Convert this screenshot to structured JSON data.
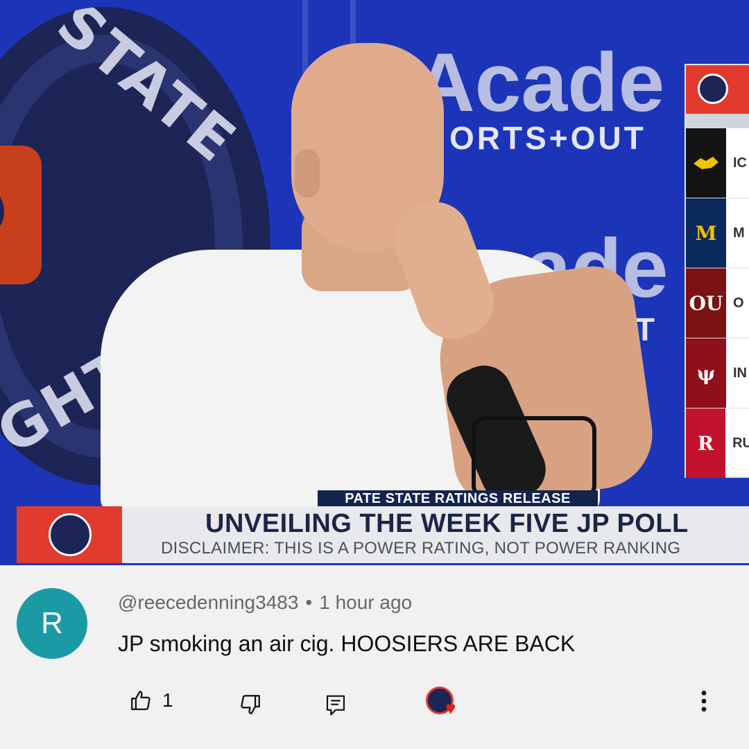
{
  "video": {
    "wall_logo_words": [
      "STATE",
      "GHT"
    ],
    "academy_text_1": "Acade",
    "academy_sub_1": "ORTS+OUT",
    "academy_text_2": "cade",
    "academy_sub_2": "+OUT",
    "standings_rows": [
      {
        "icon": "hawkeye-icon",
        "abbr": "IC",
        "color": "#141414",
        "icon_color": "#f2c200"
      },
      {
        "icon": "block-m-icon",
        "glyph": "M",
        "abbr": "M",
        "color": "#0b2a5b",
        "icon_color": "#f2c200"
      },
      {
        "icon": "ou-icon",
        "glyph": "OU",
        "abbr": "O",
        "color": "#7b1213",
        "icon_color": "#ffffff"
      },
      {
        "icon": "trident-icon",
        "glyph": "ψ",
        "abbr": "IN",
        "color": "#8f0f1a",
        "icon_color": "#ffffff"
      },
      {
        "icon": "block-r-icon",
        "glyph": "R",
        "abbr": "RU",
        "color": "#c3122e",
        "icon_color": "#ffffff"
      }
    ],
    "lower_third": {
      "tag": "PATE STATE RATINGS RELEASE",
      "headline": "UNVEILING THE WEEK FIVE JP POLL",
      "disclaimer": "DISCLAIMER: THIS IS A POWER RATING, NOT POWER RANKING"
    }
  },
  "comment": {
    "avatar_letter": "R",
    "author": "@reecedenning3483",
    "separator": "•",
    "time": "1 hour ago",
    "text": "JP smoking an air cig. HOOSIERS ARE BACK",
    "like_count": "1"
  },
  "colors": {
    "background": "#f1f1f1",
    "avatar": "#1a9aa5",
    "brand_red": "#e13a2f",
    "heart": "#e0211b"
  }
}
